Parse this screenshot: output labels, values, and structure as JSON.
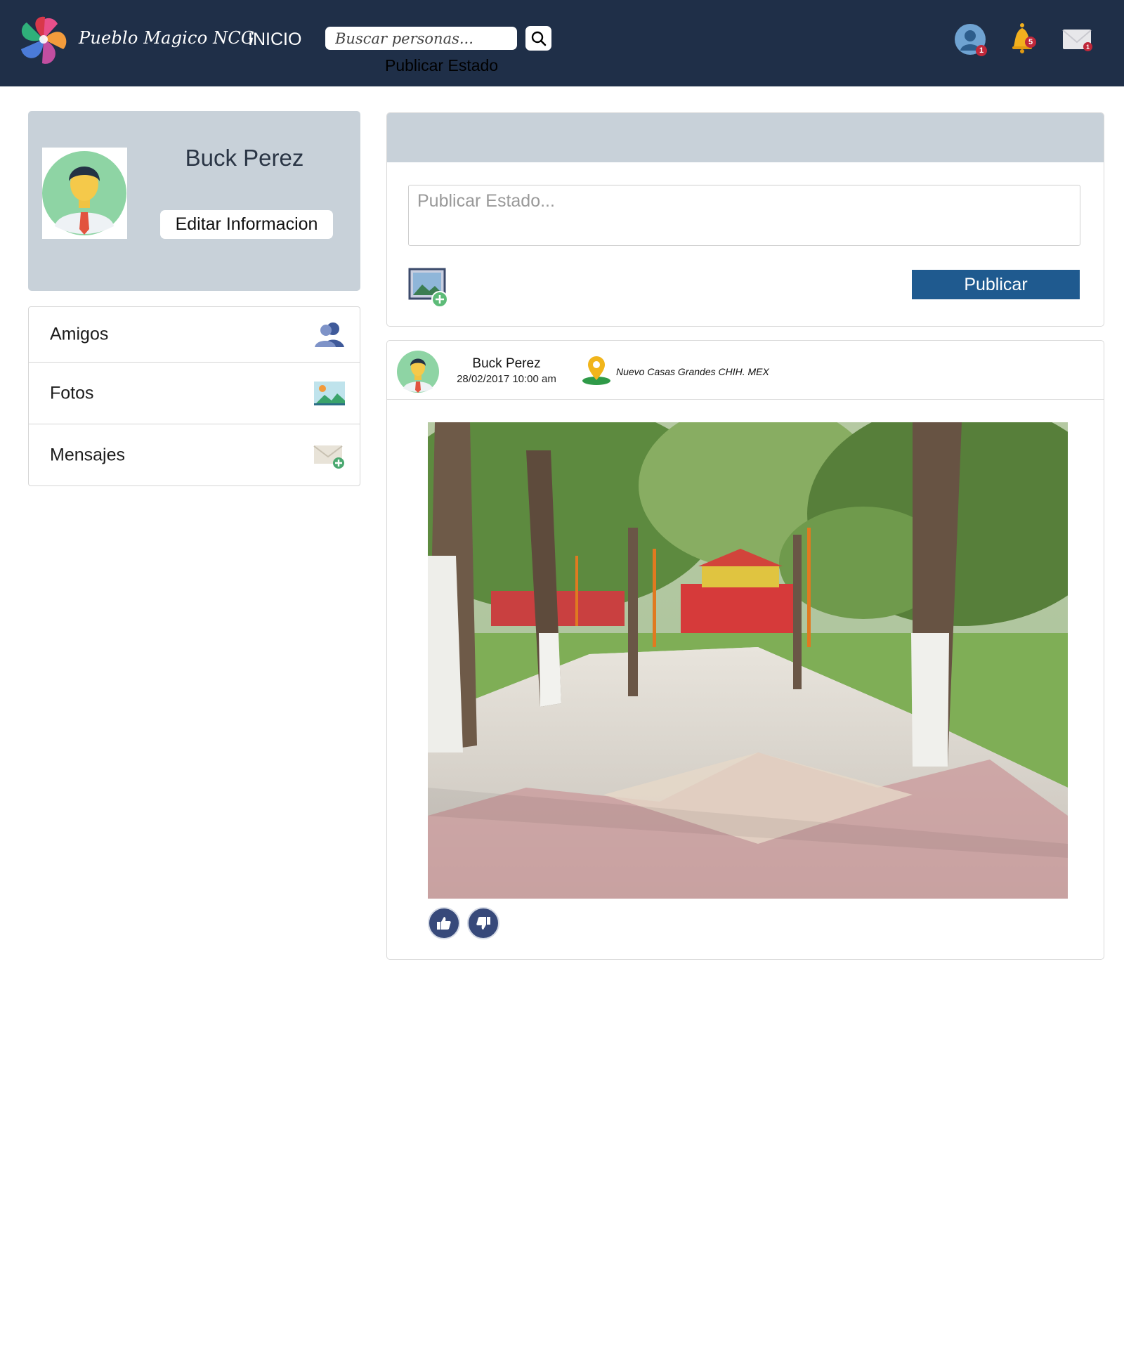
{
  "header": {
    "brand": "Pueblo Magico NCG",
    "nav_home": "INICIO",
    "search": {
      "placeholder": "Buscar personas..."
    },
    "status_link": "Publicar Estado",
    "icons": {
      "profile": {
        "name": "user-icon",
        "badge": "1"
      },
      "notifications": {
        "name": "bell-icon",
        "badge": "5"
      },
      "messages": {
        "name": "envelope-icon",
        "badge": "1"
      }
    }
  },
  "profile": {
    "name": "Buck Perez",
    "edit_label": "Editar Informacion"
  },
  "sidebar": {
    "items": [
      {
        "label": "Amigos",
        "icon": "friends-icon"
      },
      {
        "label": "Fotos",
        "icon": "photos-icon"
      },
      {
        "label": "Mensajes",
        "icon": "new-message-icon"
      }
    ]
  },
  "composer": {
    "placeholder": "Publicar Estado...",
    "publish_label": "Publicar"
  },
  "post": {
    "author": "Buck Perez",
    "date": "28/02/2017 10:00 am",
    "location": "Nuevo Casas Grandes CHIH. MEX",
    "reactions": [
      "like-icon",
      "dislike-icon"
    ]
  },
  "colors": {
    "topbar": "#1f2f48",
    "panel": "#c8d1d9",
    "primary_button": "#1f5a8f",
    "reaction": "#37497a",
    "badge": "#c0283a"
  }
}
